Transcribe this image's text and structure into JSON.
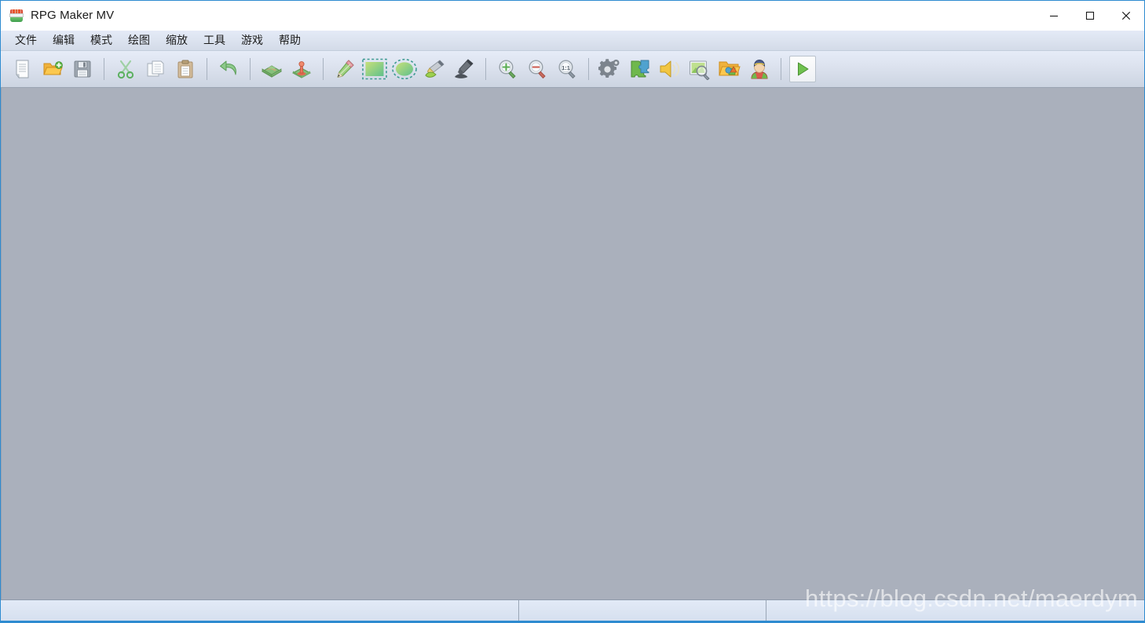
{
  "window": {
    "title": "RPG Maker MV",
    "app_icon": "rpg-maker-mv-logo-icon",
    "controls": {
      "minimize": "minimize-icon",
      "maximize": "maximize-icon",
      "close": "close-icon"
    }
  },
  "menu": {
    "items": [
      {
        "label": "文件",
        "name": "file"
      },
      {
        "label": "编辑",
        "name": "edit"
      },
      {
        "label": "模式",
        "name": "mode"
      },
      {
        "label": "绘图",
        "name": "draw"
      },
      {
        "label": "缩放",
        "name": "zoom"
      },
      {
        "label": "工具",
        "name": "tools"
      },
      {
        "label": "游戏",
        "name": "game"
      },
      {
        "label": "帮助",
        "name": "help"
      }
    ]
  },
  "toolbar": {
    "groups": [
      {
        "buttons": [
          {
            "icon": "new-project-icon",
            "tooltip": "新建工程"
          },
          {
            "icon": "open-folder-icon",
            "tooltip": "打开工程"
          },
          {
            "icon": "save-floppy-icon",
            "tooltip": "保存工程"
          }
        ]
      },
      {
        "buttons": [
          {
            "icon": "cut-scissors-icon",
            "tooltip": "剪切"
          },
          {
            "icon": "copy-pages-icon",
            "tooltip": "复制"
          },
          {
            "icon": "paste-clipboard-icon",
            "tooltip": "粘贴"
          }
        ]
      },
      {
        "buttons": [
          {
            "icon": "undo-arrow-icon",
            "tooltip": "撤销"
          }
        ]
      },
      {
        "buttons": [
          {
            "icon": "map-mode-icon",
            "tooltip": "地图模式"
          },
          {
            "icon": "event-mode-icon",
            "tooltip": "事件模式"
          }
        ]
      },
      {
        "buttons": [
          {
            "icon": "pencil-tool-icon",
            "tooltip": "铅笔",
            "selected": false
          },
          {
            "icon": "rectangle-tool-icon",
            "tooltip": "矩形",
            "selected": true
          },
          {
            "icon": "ellipse-tool-icon",
            "tooltip": "椭圆",
            "selected": false
          },
          {
            "icon": "flood-fill-icon",
            "tooltip": "填充",
            "selected": false
          },
          {
            "icon": "shadow-pen-icon",
            "tooltip": "阴影笔",
            "selected": false
          }
        ]
      },
      {
        "buttons": [
          {
            "icon": "zoom-in-icon",
            "tooltip": "放大"
          },
          {
            "icon": "zoom-out-icon",
            "tooltip": "缩小"
          },
          {
            "icon": "zoom-actual-icon",
            "tooltip": "1:1",
            "label": "1:1"
          }
        ]
      },
      {
        "buttons": [
          {
            "icon": "database-gear-icon",
            "tooltip": "数据库"
          },
          {
            "icon": "plugin-puzzle-icon",
            "tooltip": "插件管理器"
          },
          {
            "icon": "sound-test-icon",
            "tooltip": "音效测试"
          },
          {
            "icon": "image-search-icon",
            "tooltip": "素材查找"
          },
          {
            "icon": "resource-manager-icon",
            "tooltip": "资源管理器"
          },
          {
            "icon": "character-generator-icon",
            "tooltip": "角色生成器"
          }
        ]
      },
      {
        "buttons": [
          {
            "icon": "playtest-play-icon",
            "tooltip": "试玩游戏"
          }
        ]
      }
    ]
  },
  "workspace": {
    "content": ""
  },
  "status_bar": {
    "main": "",
    "middle": "",
    "right": ""
  },
  "watermark": {
    "text": "https://blog.csdn.net/maerdym"
  },
  "colors": {
    "window_border": "#2e8bd0",
    "title_bg": "#ffffff",
    "menu_bg": "#dde4f0",
    "toolbar_top": "#e6ecf8",
    "toolbar_bottom": "#ccd4e1",
    "workspace_bg": "#aab0bc",
    "status_bg": "#dbe4f2",
    "accent_green": "#66b85a",
    "accent_red": "#d94a30"
  }
}
